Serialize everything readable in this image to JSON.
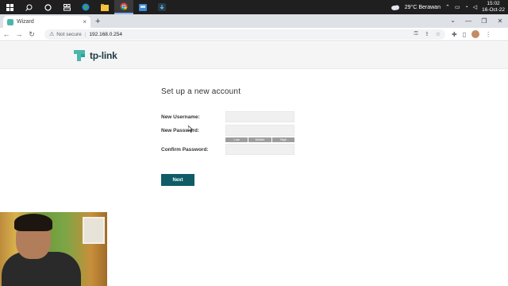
{
  "taskbar": {
    "icons": [
      "windows-icon",
      "search-icon",
      "task-view-icon",
      "widgets-icon",
      "edge-icon",
      "file-explorer-icon",
      "chrome-icon",
      "app-icon",
      "app-icon-2"
    ],
    "weather_text": "29°C  Berawan",
    "time": "15:02",
    "date": "16-Oct-22"
  },
  "browser": {
    "tab_title": "Wizard",
    "tab_close": "×",
    "new_tab": "+",
    "security_label": "Not secure",
    "url": "192.168.0.254"
  },
  "page": {
    "logo_text": "tp-link",
    "heading": "Set up a new account",
    "new_username_label": "New Username:",
    "new_password_label": "New Password:",
    "confirm_password_label": "Confirm Password:",
    "strength_low": "Low",
    "strength_middle": "Middle",
    "strength_high": "High",
    "next_button": "Next"
  },
  "colors": {
    "brand_teal": "#4db6ac",
    "button_bg": "#0f5c66"
  }
}
